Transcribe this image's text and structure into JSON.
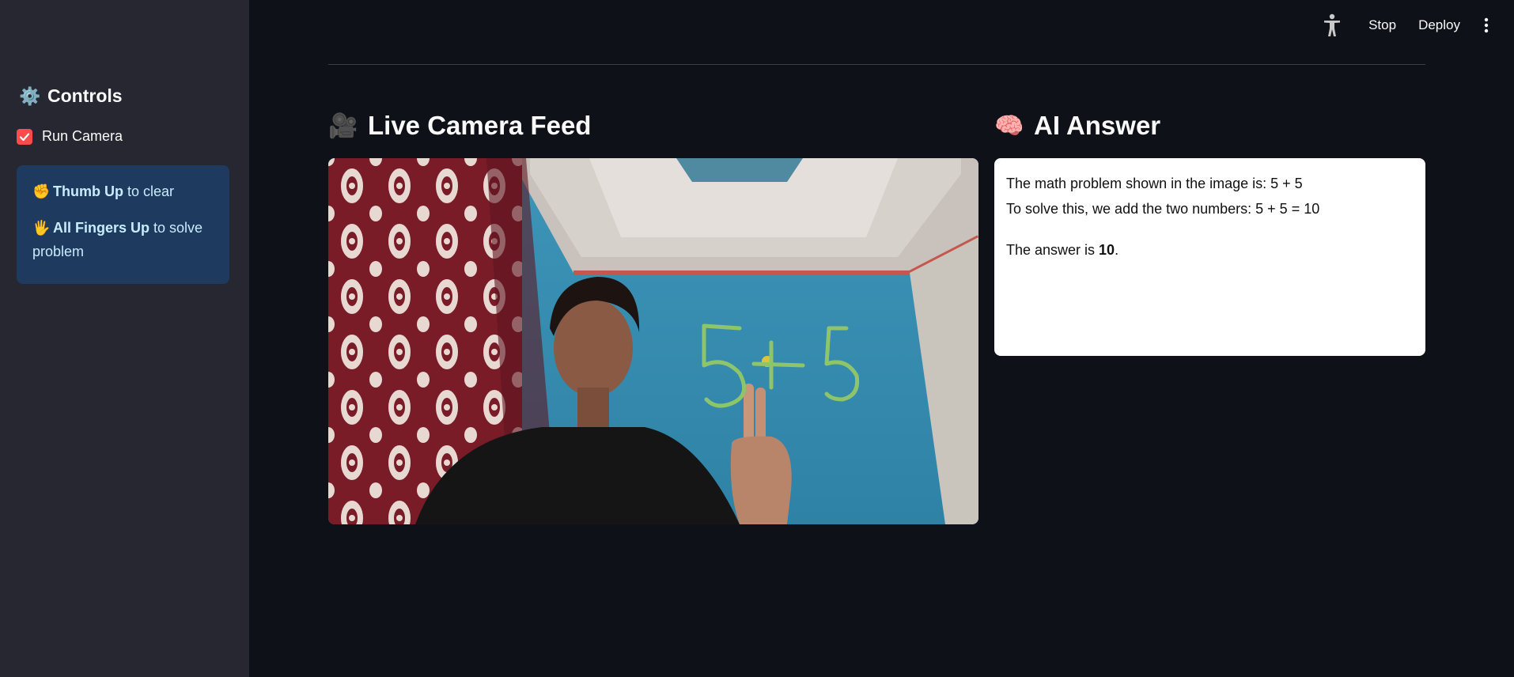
{
  "sidebar": {
    "header_icon": "gear-icon",
    "header_emoji": "⚙️",
    "header_title": "Controls",
    "run_camera": {
      "label": "Run Camera",
      "checked": true
    },
    "instructions": {
      "line1": {
        "emoji": "✊",
        "bold": "Thumb Up",
        "text": " to clear"
      },
      "line2": {
        "emoji": "🖐",
        "bold": "All Fingers Up",
        "text": " to solve problem"
      }
    }
  },
  "toolbar": {
    "accessibility_icon": "accessibility-icon",
    "stop_label": "Stop",
    "deploy_label": "Deploy",
    "menu_icon": "kebab-menu-icon"
  },
  "main": {
    "camera_header": {
      "emoji": "🎥",
      "title": "Live Camera Feed"
    },
    "answer_header": {
      "emoji": "🧠",
      "title": "AI Answer"
    },
    "camera_overlay_text": "5+5",
    "answer": {
      "line1": "The math problem shown in the image is: 5 + 5",
      "line2": "To solve this, we add the two numbers: 5 + 5 = 10",
      "line3_prefix": "The answer is ",
      "line3_bold": "10",
      "line3_suffix": "."
    }
  },
  "colors": {
    "accent": "#ff4b4b",
    "background": "#0e1117",
    "sidebar": "#262730",
    "info_box": "#1f3a5f",
    "info_text": "#c7ebff"
  }
}
